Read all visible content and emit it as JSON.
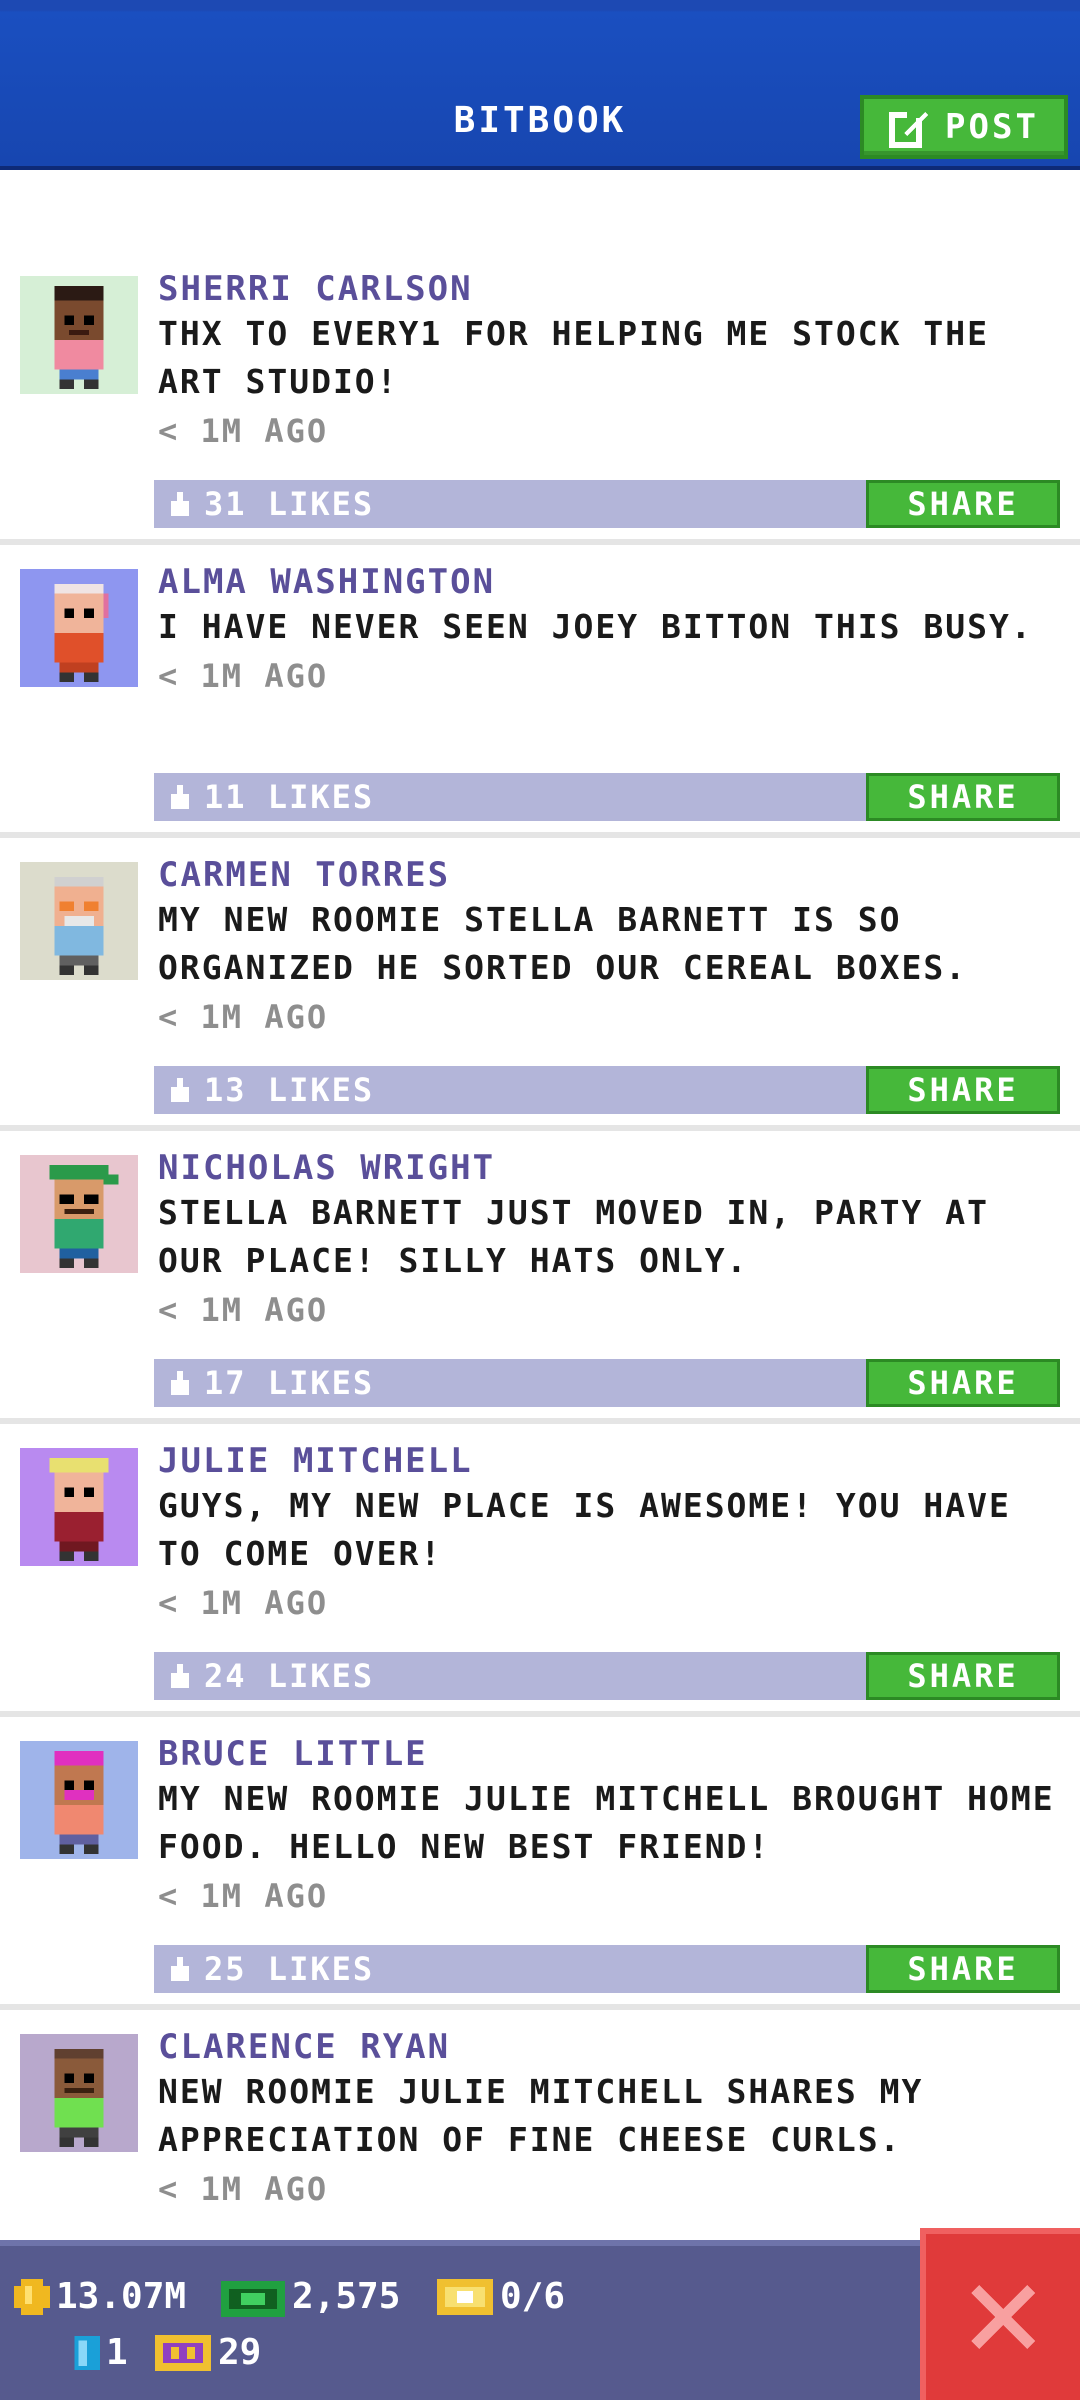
{
  "header": {
    "title": "BITBOOK",
    "post_label": "POST"
  },
  "posts": [
    {
      "author": "SHERRI CARLSON",
      "message": "THX TO EVERY1 FOR HELPING ME STOCK THE ART STUDIO!",
      "time": "< 1M AGO",
      "likes": "31 LIKES",
      "share": "SHARE",
      "avatar_bg": "#d6efd6"
    },
    {
      "author": "ALMA WASHINGTON",
      "message": "I HAVE NEVER SEEN JOEY BITTON THIS BUSY.",
      "time": "< 1M AGO",
      "likes": "11 LIKES",
      "share": "SHARE",
      "avatar_bg": "#8e96f0"
    },
    {
      "author": "CARMEN TORRES",
      "message": "MY NEW ROOMIE STELLA BARNETT IS SO ORGANIZED HE SORTED OUR CEREAL BOXES.",
      "time": "< 1M AGO",
      "likes": "13 LIKES",
      "share": "SHARE",
      "avatar_bg": "#dcdccc"
    },
    {
      "author": "NICHOLAS WRIGHT",
      "message": "STELLA BARNETT JUST MOVED IN, PARTY AT OUR PLACE! SILLY HATS ONLY.",
      "time": "< 1M AGO",
      "likes": "17 LIKES",
      "share": "SHARE",
      "avatar_bg": "#e8c6cf"
    },
    {
      "author": "JULIE MITCHELL",
      "message": "GUYS, MY NEW PLACE IS AWESOME! YOU HAVE TO COME OVER!",
      "time": "< 1M AGO",
      "likes": "24 LIKES",
      "share": "SHARE",
      "avatar_bg": "#b98af0"
    },
    {
      "author": "BRUCE LITTLE",
      "message": "MY NEW ROOMIE JULIE MITCHELL BROUGHT HOME FOOD. HELLO NEW BEST FRIEND!",
      "time": "< 1M AGO",
      "likes": "25 LIKES",
      "share": "SHARE",
      "avatar_bg": "#9fb4ea"
    },
    {
      "author": "CLARENCE RYAN",
      "message": "NEW ROOMIE JULIE MITCHELL SHARES MY APPRECIATION OF FINE CHEESE CURLS.",
      "time": "< 1M AGO",
      "likes": "",
      "share": "",
      "avatar_bg": "#b8a8cc"
    }
  ],
  "status": {
    "coins": "13.07M",
    "bux": "2,575",
    "tickets": "0/6",
    "level_items": "1",
    "vip": "29"
  },
  "colors": {
    "header_blue": "#1a4fc0",
    "share_green": "#46b83a",
    "like_bar": "#b3b5d9",
    "author_purple": "#5a4f9a",
    "status_bar": "#565a8e",
    "close_red": "#e03a3a"
  }
}
